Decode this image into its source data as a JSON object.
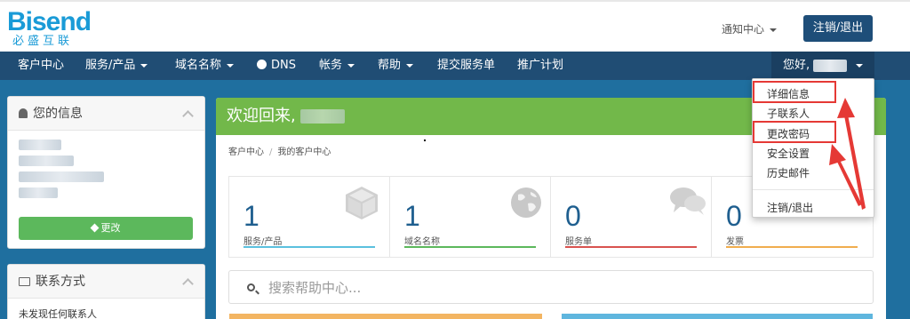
{
  "brand": {
    "name": "Bisend",
    "tagline": "必盛互联",
    "color": "#1a9bd7"
  },
  "header": {
    "notify_label": "通知中心",
    "logout_button": "注销/退出"
  },
  "nav": {
    "items": [
      {
        "label": "客户中心",
        "caret": false
      },
      {
        "label": "服务/产品",
        "caret": true
      },
      {
        "label": "域名名称",
        "caret": true
      },
      {
        "label": "DNS",
        "caret": false,
        "icon": "globe-icon"
      },
      {
        "label": "帐务",
        "caret": true
      },
      {
        "label": "帮助",
        "caret": true
      },
      {
        "label": "提交服务单",
        "caret": false
      },
      {
        "label": "推广计划",
        "caret": false
      }
    ],
    "user_greeting": "您好,"
  },
  "sidebar": {
    "info_title": "您的信息",
    "edit_button": "更改",
    "contacts_title": "联系方式",
    "contacts_empty": "未发现任何联系人"
  },
  "main": {
    "welcome": "欢迎回来,",
    "breadcrumb": [
      "客户中心",
      "我的客户中心"
    ],
    "stats": [
      {
        "value": "1",
        "label": "服务/产品",
        "icon": "cube-icon",
        "color": "#5bc0de"
      },
      {
        "value": "1",
        "label": "域名名称",
        "icon": "globe-icon",
        "color": "#5cb85c"
      },
      {
        "value": "0",
        "label": "服务单",
        "icon": "comments-icon",
        "color": "#d9534f"
      },
      {
        "value": "0",
        "label": "发票",
        "icon": "credit-card-icon",
        "color": "#f0ad4e"
      }
    ],
    "search_placeholder": "搜索帮助中心..."
  },
  "user_menu": {
    "items": [
      "详细信息",
      "子联系人",
      "更改密码",
      "安全设置",
      "历史邮件",
      "注销/退出"
    ],
    "highlighted": [
      "详细信息",
      "更改密码"
    ]
  },
  "colors": {
    "nav": "#204d74",
    "welcome": "#72b84a",
    "annotation": "#e53935",
    "accent_button": "#1e4e79"
  }
}
